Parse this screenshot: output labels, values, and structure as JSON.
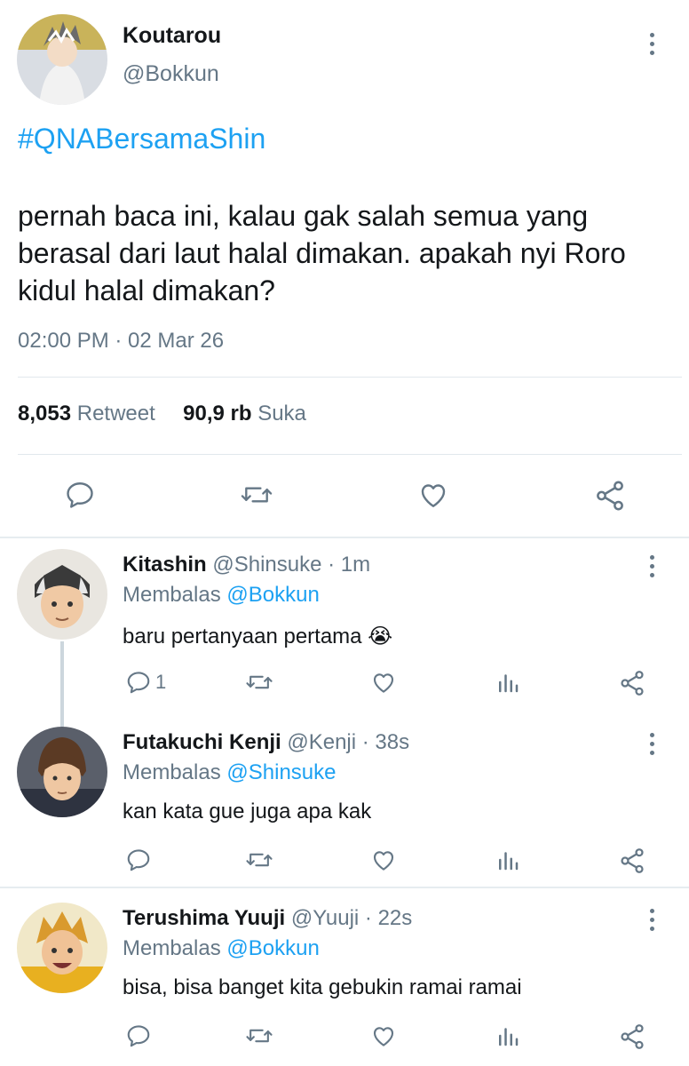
{
  "main": {
    "name": "Koutarou",
    "handle": "@Bokkun",
    "hashtag": "#QNABersamaShin",
    "text": "pernah baca ini, kalau gak salah semua yang berasal dari laut halal dimakan. apakah nyi Roro kidul halal dimakan?",
    "time": "02:00 PM · 02 Mar 26",
    "retweet_count": "8,053",
    "retweet_label": "Retweet",
    "like_count": "90,9 rb",
    "like_label": "Suka"
  },
  "replies": [
    {
      "name": "Kitashin",
      "handle": "@Shinsuke",
      "time": "· 1m",
      "reply_prefix": "Membalas",
      "reply_to": "@Bokkun",
      "text": "baru pertanyaan pertama 😭",
      "reply_count": "1"
    },
    {
      "name": "Futakuchi Kenji",
      "handle": "@Kenji",
      "time": "· 38s",
      "reply_prefix": "Membalas",
      "reply_to": "@Shinsuke",
      "text": "kan kata gue juga apa kak",
      "reply_count": ""
    },
    {
      "name": "Terushima Yuuji",
      "handle": "@Yuuji",
      "time": "· 22s",
      "reply_prefix": "Membalas",
      "reply_to": "@Bokkun",
      "text": "bisa, bisa banget kita gebukin ramai ramai",
      "reply_count": ""
    }
  ],
  "icons": {
    "reply": "speech-bubble-icon",
    "retweet": "retweet-icon",
    "like": "heart-icon",
    "analytics": "bar-chart-icon",
    "share": "share-icon",
    "more": "vertical-dots-icon"
  },
  "colors": {
    "link": "#1da1f2",
    "secondary_text": "#657786",
    "primary_text": "#14171a",
    "divider": "#e1e8ed"
  }
}
